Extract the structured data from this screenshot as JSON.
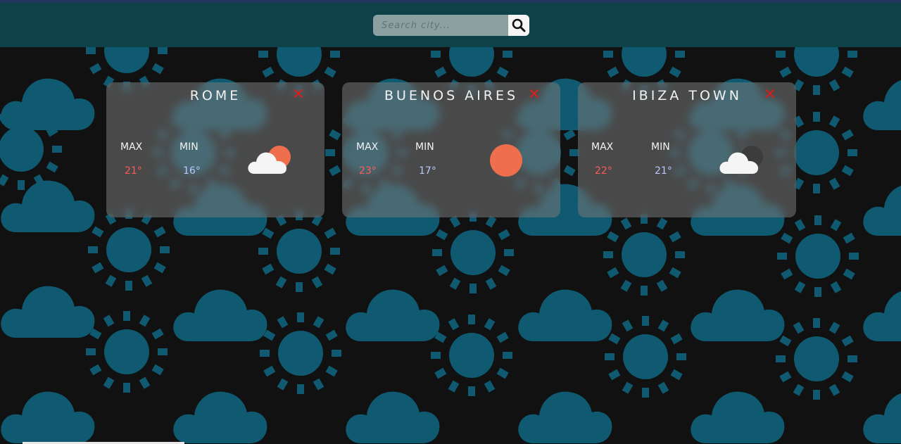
{
  "search": {
    "placeholder": "Search city...",
    "value": ""
  },
  "cards": [
    {
      "city": "ROME",
      "close_label": "✕",
      "max_label": "MAX",
      "min_label": "MIN",
      "max": "21°",
      "min": "16°",
      "icon": "partly-sunny-icon"
    },
    {
      "city": "BUENOS AIRES",
      "close_label": "✕",
      "max_label": "MAX",
      "min_label": "MIN",
      "max": "23°",
      "min": "17°",
      "icon": "sun-icon"
    },
    {
      "city": "IBIZA TOWN",
      "close_label": "✕",
      "max_label": "MAX",
      "min_label": "MIN",
      "max": "22°",
      "min": "21°",
      "icon": "cloud-moon-icon"
    }
  ],
  "colors": {
    "accent_sun": "#ef6e4d",
    "max_temp": "#ff5a5a",
    "min_temp": "#b9c8ff",
    "pattern": "#0f5a70",
    "header": "#0f4248"
  }
}
